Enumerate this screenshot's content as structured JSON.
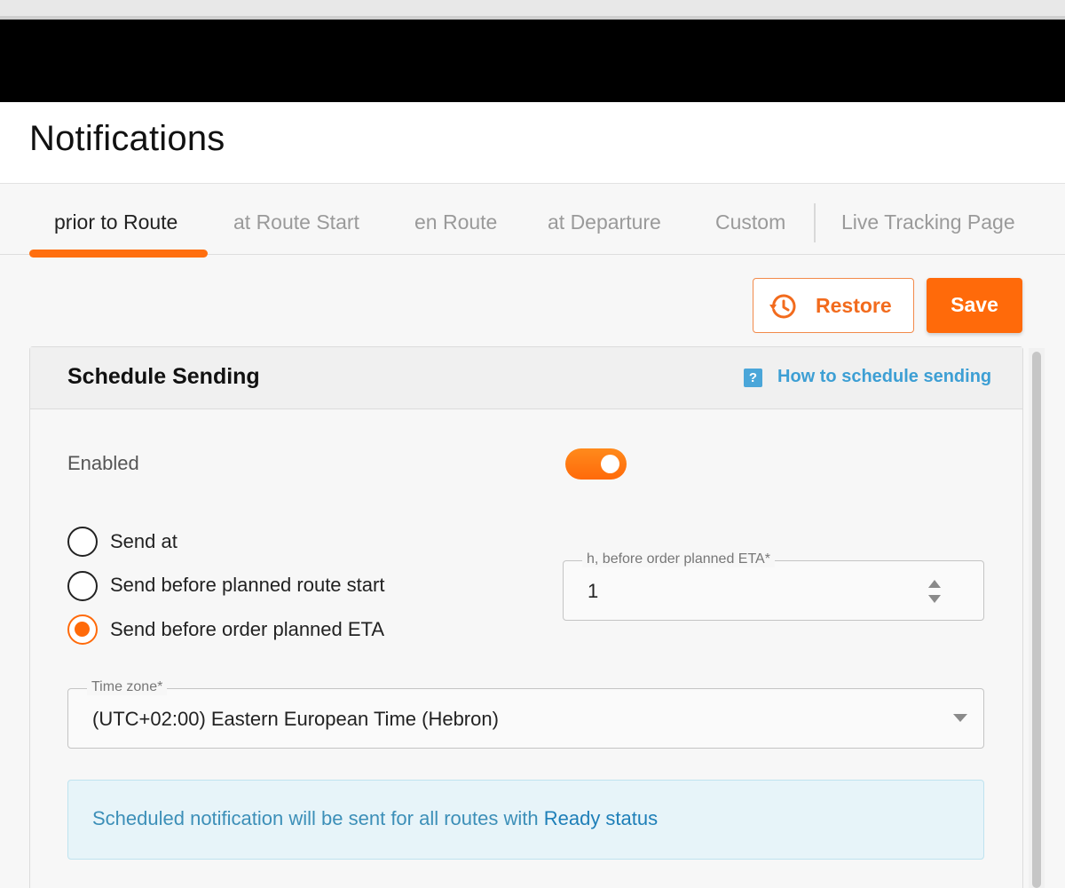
{
  "page": {
    "title": "Notifications"
  },
  "tabs": [
    {
      "label": "prior to Route",
      "active": true
    },
    {
      "label": "at Route Start",
      "active": false
    },
    {
      "label": "en Route",
      "active": false
    },
    {
      "label": "at Departure",
      "active": false
    },
    {
      "label": "Custom",
      "active": false
    },
    {
      "label": "Live Tracking Page",
      "active": false
    }
  ],
  "actions": {
    "restore_label": "Restore",
    "restore_icon": "history-icon",
    "save_label": "Save"
  },
  "panel": {
    "title": "Schedule Sending",
    "help_icon_glyph": "?",
    "help_link": "How to schedule sending",
    "enabled_label": "Enabled",
    "enabled": true,
    "radio_options": [
      {
        "label": "Send at",
        "checked": false
      },
      {
        "label": "Send before planned route start",
        "checked": false
      },
      {
        "label": "Send before order planned ETA",
        "checked": true
      }
    ],
    "hours_field": {
      "legend": "h, before order planned ETA*",
      "value": "1"
    },
    "timezone_field": {
      "legend": "Time zone*",
      "value": "(UTC+02:00) Eastern European Time (Hebron)"
    },
    "info": {
      "text": "Scheduled notification will be sent for all routes with ",
      "link": "Ready status"
    }
  },
  "colors": {
    "accent": "#ff6a0a",
    "info_bg": "#e7f4f9",
    "link": "#3d9fd4"
  }
}
